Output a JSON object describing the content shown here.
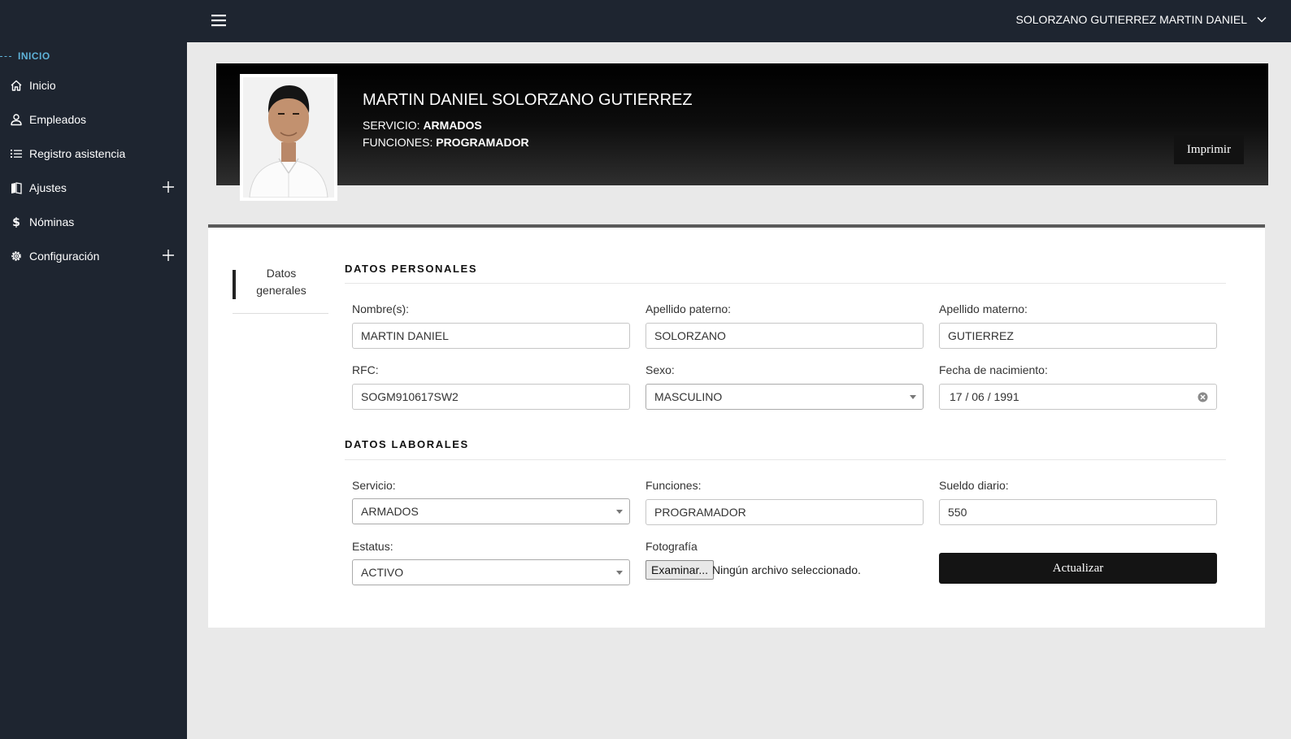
{
  "sidebar": {
    "section_label": "INICIO",
    "items": [
      {
        "label": "Inicio",
        "icon": "home-icon"
      },
      {
        "label": "Empleados",
        "icon": "user-icon"
      },
      {
        "label": "Registro asistencia",
        "icon": "list-icon"
      },
      {
        "label": "Ajustes",
        "icon": "book-icon",
        "expandable": true
      },
      {
        "label": "Nóminas",
        "icon": "dollar-icon"
      },
      {
        "label": "Configuración",
        "icon": "gear-icon",
        "expandable": true
      }
    ]
  },
  "topbar": {
    "user_name": "SOLORZANO GUTIERREZ MARTIN DANIEL"
  },
  "profile": {
    "full_name": "MARTIN DANIEL SOLORZANO GUTIERREZ",
    "servicio_label": "SERVICIO:",
    "servicio_value": "ARMADOS",
    "funciones_label": "FUNCIONES:",
    "funciones_value": "PROGRAMADOR",
    "print_label": "Imprimir"
  },
  "tabs": {
    "general_line1": "Datos",
    "general_line2": "generales"
  },
  "personal": {
    "title": "DATOS PERSONALES",
    "nombre_label": "Nombre(s):",
    "nombre_value": "MARTIN DANIEL",
    "paterno_label": "Apellido paterno:",
    "paterno_value": "SOLORZANO",
    "materno_label": "Apellido materno:",
    "materno_value": "GUTIERREZ",
    "rfc_label": "RFC:",
    "rfc_value": "SOGM910617SW2",
    "sexo_label": "Sexo:",
    "sexo_value": "MASCULINO",
    "fecha_label": "Fecha de nacimiento:",
    "fecha_value": "17 / 06 / 1991"
  },
  "laboral": {
    "title": "DATOS LABORALES",
    "servicio_label": "Servicio:",
    "servicio_value": "ARMADOS",
    "funciones_label": "Funciones:",
    "funciones_value": "PROGRAMADOR",
    "sueldo_label": "Sueldo diario:",
    "sueldo_value": "550",
    "estatus_label": "Estatus:",
    "estatus_value": "ACTIVO",
    "foto_label": "Fotografía",
    "file_button": "Examinar...",
    "file_status": "Ningún archivo seleccionado.",
    "update_label": "Actualizar"
  },
  "colors": {
    "sidebar_bg": "#1e2530",
    "accent": "#5fb3d9",
    "button_bg": "#141414"
  }
}
